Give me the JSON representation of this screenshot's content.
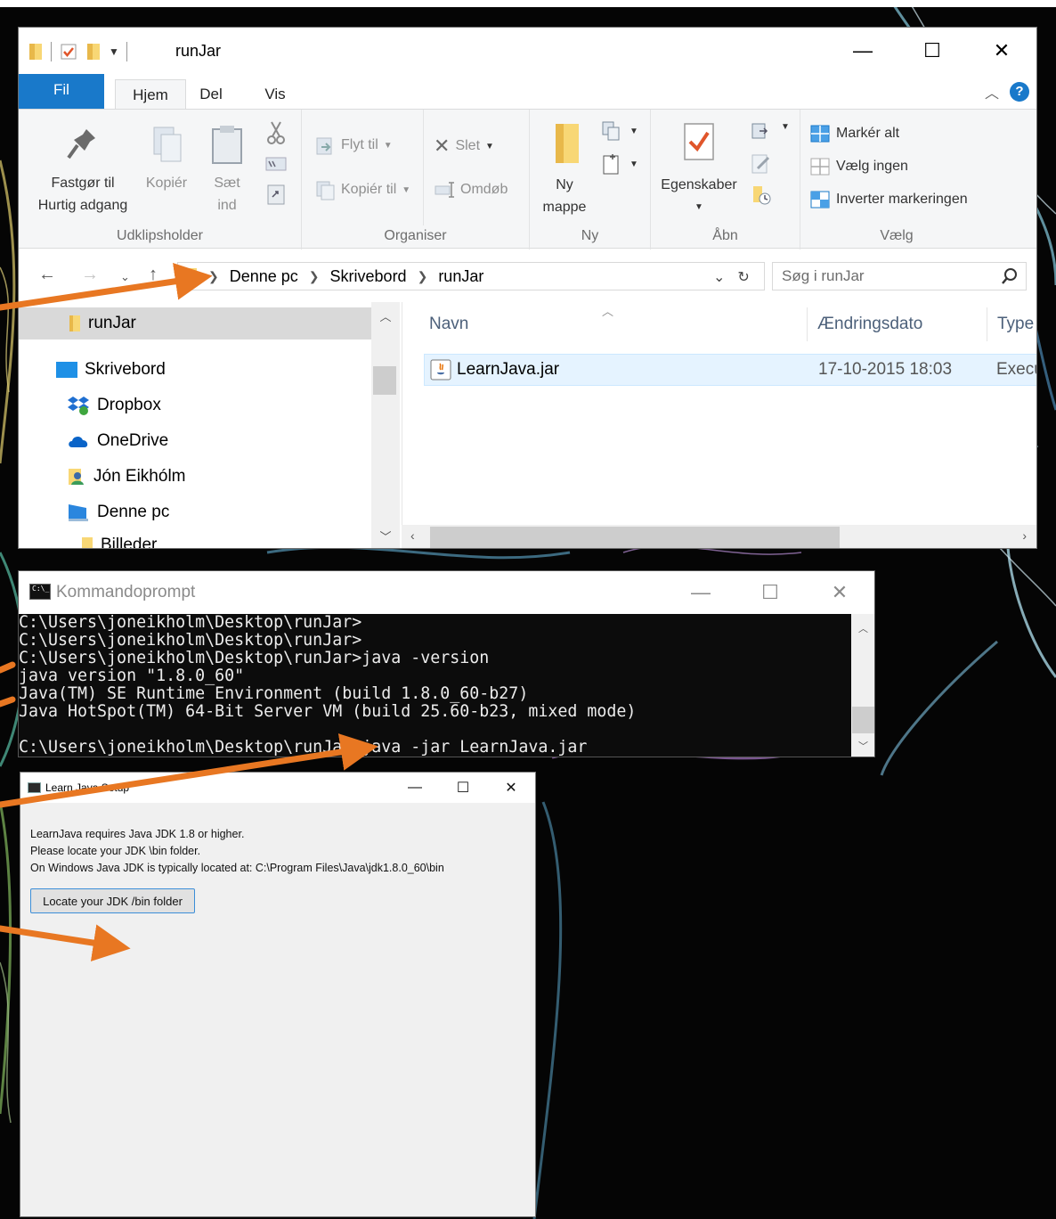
{
  "explorer": {
    "title": "runJar",
    "window_controls": {
      "minimize": "—",
      "maximize": "☐",
      "close": "✕"
    },
    "tabs": [
      "Fil",
      "Hjem",
      "Del",
      "Vis"
    ],
    "ribbon": {
      "clipboard": {
        "pin_line1": "Fastgør til",
        "pin_line2": "Hurtig adgang",
        "copy": "Kopiér",
        "paste_line1": "Sæt",
        "paste_line2": "ind",
        "label": "Udklipsholder"
      },
      "organize": {
        "move_to": "Flyt til",
        "copy_to": "Kopiér til",
        "delete": "Slet",
        "rename": "Omdøb",
        "label": "Organiser"
      },
      "new": {
        "new_folder_line1": "Ny",
        "new_folder_line2": "mappe",
        "label": "Ny"
      },
      "open": {
        "properties": "Egenskaber",
        "label": "Åbn"
      },
      "select": {
        "select_all": "Markér alt",
        "select_none": "Vælg ingen",
        "invert": "Inverter markeringen",
        "label": "Vælg"
      }
    },
    "address": {
      "crumbs": [
        "Denne pc",
        "Skrivebord",
        "runJar"
      ],
      "search_placeholder": "Søg i runJar"
    },
    "nav": {
      "selected": "runJar",
      "items": [
        "Skrivebord",
        "Dropbox",
        "OneDrive",
        "Jón Eikhólm",
        "Denne pc",
        "Billeder"
      ]
    },
    "columns": {
      "name": "Navn",
      "date": "Ændringsdato",
      "type": "Type"
    },
    "files": [
      {
        "name": "LearnJava.jar",
        "date": "17-10-2015 18:03",
        "type": "Execu"
      }
    ]
  },
  "cmd": {
    "title": "Kommandoprompt",
    "icon_text": "C:\\_",
    "lines": [
      "C:\\Users\\joneikholm\\Desktop\\runJar>",
      "C:\\Users\\joneikholm\\Desktop\\runJar>",
      "C:\\Users\\joneikholm\\Desktop\\runJar>java -version",
      "java version \"1.8.0_60\"",
      "Java(TM) SE Runtime Environment (build 1.8.0_60-b27)",
      "Java HotSpot(TM) 64-Bit Server VM (build 25.60-b23, mixed mode)",
      "",
      "C:\\Users\\joneikholm\\Desktop\\runJar>java -jar LearnJava.jar"
    ]
  },
  "dialog": {
    "title": "Learn Java Setup",
    "line1": "LearnJava requires Java JDK 1.8 or higher.",
    "line2": "Please locate your JDK \\bin folder.",
    "line3": "On Windows Java JDK is typically located at: C:\\Program Files\\Java\\jdk1.8.0_60\\bin",
    "button": "Locate your JDK /bin folder"
  },
  "colors": {
    "accent": "#1979ca",
    "arrow": "#e87722",
    "console_bg": "#0c0c0c"
  }
}
